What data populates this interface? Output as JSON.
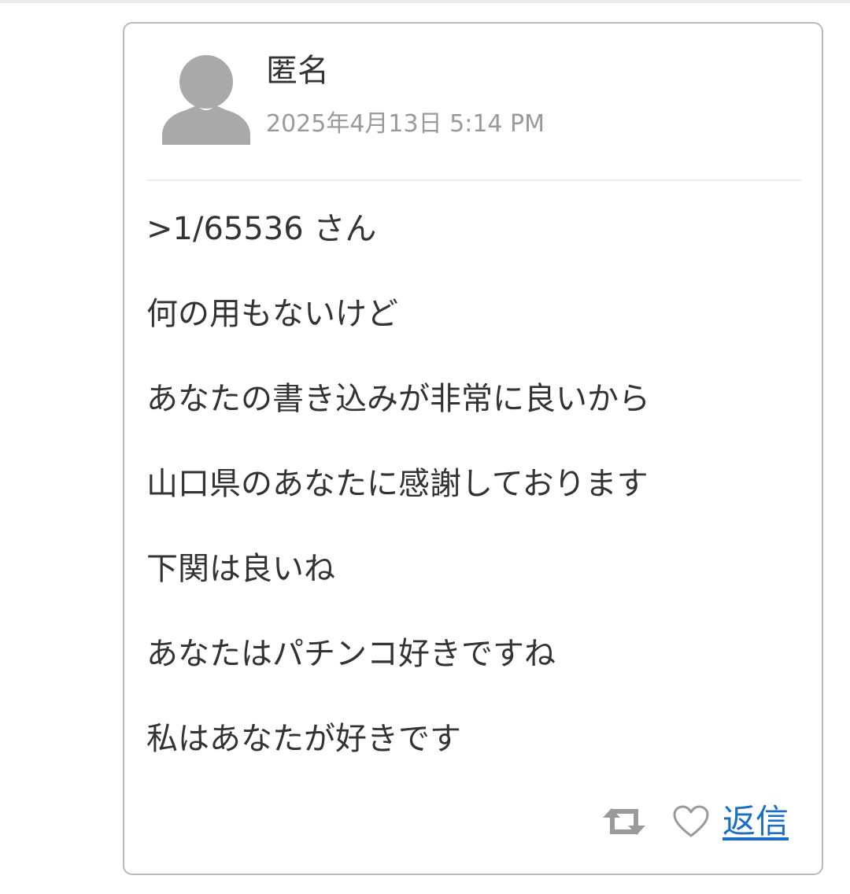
{
  "comment": {
    "author": "匿名",
    "timestamp": "2025年4月13日 5:14 PM",
    "lines": [
      ">1/65536 さん",
      "何の用もないけど",
      "あなたの書き込みが非常に良いから",
      "山口県のあなたに感謝しております",
      "下関は良いね",
      "あなたはパチンコ好きですね",
      "私はあなたが好きです"
    ],
    "actions": {
      "reply_label": "返信",
      "retweet_icon": "retweet-icon",
      "like_icon": "heart-icon"
    }
  },
  "colors": {
    "text": "#333333",
    "muted": "#9a9a9a",
    "link": "#1a6fc4",
    "icon": "#9a9a9a",
    "border": "#b9b9b9"
  }
}
